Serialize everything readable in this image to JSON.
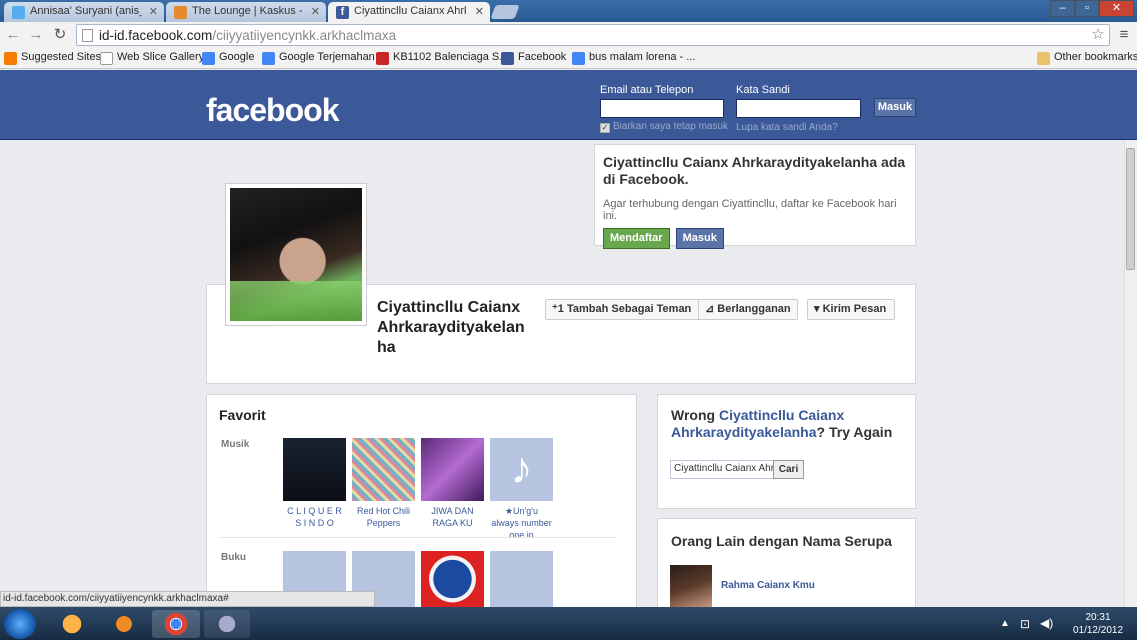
{
  "tabs": [
    {
      "label": "Annisaa' Suryani (anis_su",
      "icon": "twitter-icon",
      "color": "#55acee"
    },
    {
      "label": "The Lounge | Kaskus - Th",
      "icon": "kaskus-icon",
      "color": "#e58a2e"
    },
    {
      "label": "Ciyattincllu Caianx Ahrka",
      "icon": "facebook-icon",
      "color": "#3b5998"
    }
  ],
  "address": {
    "domain": "id-id.facebook.com",
    "path": "/ciiyyatiiyencynkk.arkhaclmaxa"
  },
  "bookmarks": [
    {
      "label": "Suggested Sites",
      "color": "#f57c00"
    },
    {
      "label": "Web Slice Gallery",
      "color": "#ddd"
    },
    {
      "label": "Google",
      "color": "#4285f4"
    },
    {
      "label": "Google Terjemahan",
      "color": "#4285f4"
    },
    {
      "label": "KB1102 Balenciaga S...",
      "color": "#c62828"
    },
    {
      "label": "Facebook",
      "color": "#3b5998"
    },
    {
      "label": "bus malam lorena - ...",
      "color": "#4285f4"
    }
  ],
  "other_bookmarks": "Other bookmarks",
  "header": {
    "logo": "facebook",
    "email_label": "Email atau Telepon",
    "password_label": "Kata Sandi",
    "login_button": "Masuk",
    "remember": "Biarkan saya tetap masuk",
    "forgot": "Lupa kata sandi Anda?"
  },
  "signup": {
    "title": "Ciyattincllu Caianx Ahrkaraydityakelanha ada di Facebook.",
    "text": "Agar terhubung dengan Ciyattincllu, daftar ke Facebook hari ini.",
    "signup_button": "Mendaftar",
    "login_button": "Masuk"
  },
  "profile": {
    "name": "Ciyattincllu Caianx Ahrkaraydityakelanha",
    "add_friend": "Tambah Sebagai Teman",
    "subscribe": "Berlangganan",
    "message": "Kirim Pesan"
  },
  "favorites": {
    "title": "Favorit",
    "music_label": "Musik",
    "music": [
      "C L I Q U E R S I N D O",
      "Red Hot Chili Peppers",
      "JIWA DAN RAGA KU",
      "★Un'g'u always number one in"
    ],
    "books_label": "Buku"
  },
  "wrong": {
    "prefix": "Wrong ",
    "name": "Ciyattincllu Caianx Ahrkaraydityakelanha",
    "suffix": "? Try Again",
    "search_value": "Ciyattincllu Caianx Ahrka",
    "search_button": "Cari"
  },
  "others": {
    "title": "Orang Lain dengan Nama Serupa",
    "person": "Rahma Caianx Kmu"
  },
  "status_url": "id-id.facebook.com/ciiyyatiiyencynkk.arkhaclmaxa#",
  "clock": {
    "time": "20:31",
    "date": "01/12/2012"
  }
}
